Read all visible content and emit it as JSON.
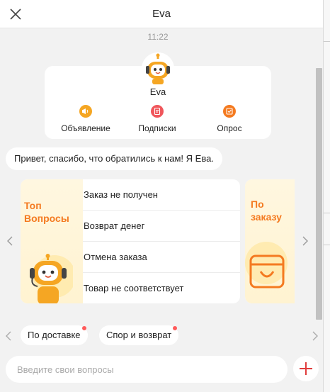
{
  "window": {
    "title": "Eva"
  },
  "chat": {
    "timestamp": "11:22",
    "bot": {
      "name": "Eva",
      "actions": [
        {
          "label": "Объявление",
          "icon": "megaphone-icon",
          "color": "#f5a623"
        },
        {
          "label": "Подписки",
          "icon": "subscription-icon",
          "color": "#f0565b"
        },
        {
          "label": "Опрос",
          "icon": "survey-icon",
          "color": "#f47a20"
        }
      ]
    },
    "greeting": "Привет, спасибо, что обратились к нам! Я Ева."
  },
  "carousel": {
    "top_questions": {
      "heading": "Топ Вопросы",
      "items": [
        "Заказ не получен",
        "Возврат денег",
        "Отмена заказа",
        "Товар не соответствует"
      ]
    },
    "order_card": {
      "heading": "По заказу"
    }
  },
  "chips": [
    "По доставке",
    "Спор и возврат"
  ],
  "input": {
    "placeholder": "Введите свои вопросы",
    "value": ""
  },
  "colors": {
    "accent": "#f47a20",
    "plus": "#e03c3c",
    "badge": "#ff5a5a"
  }
}
